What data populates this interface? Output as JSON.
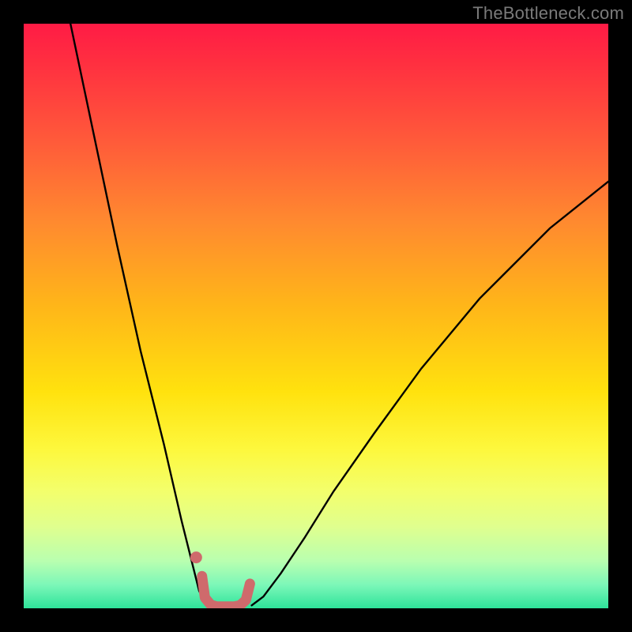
{
  "watermark": "TheBottleneck.com",
  "chart_data": {
    "type": "line",
    "title": "",
    "xlabel": "",
    "ylabel": "",
    "xlim": [
      0,
      100
    ],
    "ylim": [
      0,
      100
    ],
    "grid": false,
    "legend": null,
    "background_gradient": {
      "top": "#ff1b45",
      "mid": "#ffe20e",
      "bottom": "#2ee39a"
    },
    "series": [
      {
        "name": "left-curve",
        "color": "#000000",
        "x": [
          8,
          12,
          16,
          20,
          24,
          27,
          29,
          30,
          31,
          32
        ],
        "y": [
          100,
          81,
          62,
          44,
          28,
          15,
          7,
          3,
          1,
          0.5
        ]
      },
      {
        "name": "right-curve",
        "color": "#000000",
        "x": [
          39,
          41,
          44,
          48,
          53,
          60,
          68,
          78,
          90,
          100
        ],
        "y": [
          0.5,
          2,
          6,
          12,
          20,
          30,
          41,
          53,
          65,
          73
        ]
      },
      {
        "name": "marker-curve",
        "color": "#cf6a6c",
        "x": [
          30.5,
          31,
          32,
          33,
          34,
          35,
          36,
          37,
          38,
          38.7
        ],
        "y": [
          5.5,
          1.8,
          0.6,
          0.3,
          0.3,
          0.3,
          0.3,
          0.5,
          1.4,
          4.2
        ]
      },
      {
        "name": "marker-dot",
        "color": "#cf6a6c",
        "x": [
          29.5
        ],
        "y": [
          8.7
        ]
      }
    ]
  }
}
